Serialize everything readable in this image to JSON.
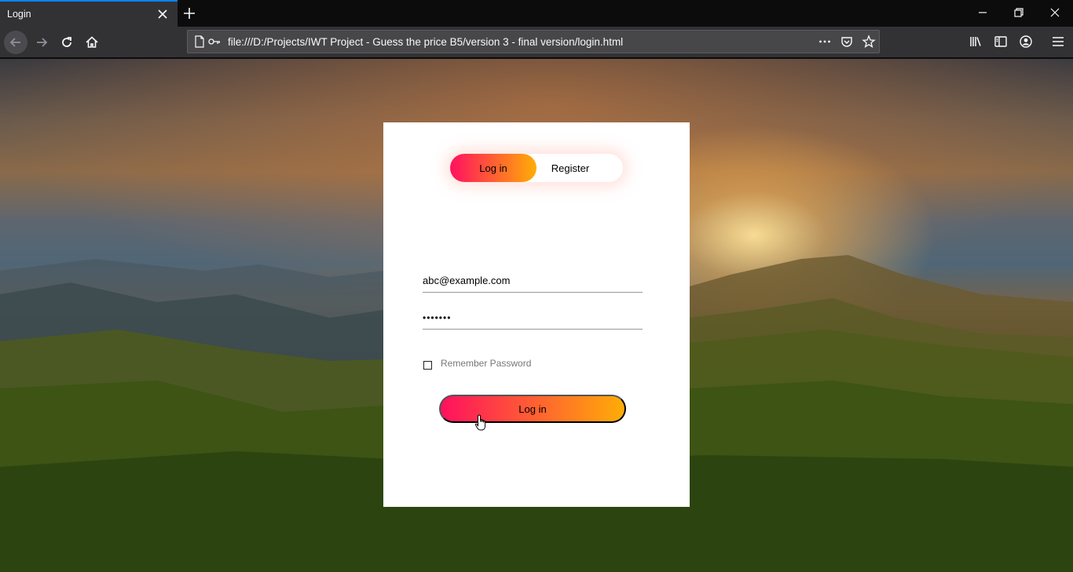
{
  "browser": {
    "tab": {
      "title": "Login"
    },
    "url": "file:///D:/Projects/IWT Project - Guess the price B5/version 3 - final version/login.html",
    "icons": {
      "tab_close": "close-icon",
      "new_tab": "plus-icon",
      "minimize": "minimize-icon",
      "restore": "restore-icon",
      "close_window": "close-icon",
      "back": "back-arrow-icon",
      "forward": "forward-arrow-icon",
      "reload": "reload-icon",
      "home": "home-icon",
      "page": "page-icon",
      "key": "key-icon",
      "more": "more-dots-icon",
      "pocket": "pocket-icon",
      "bookmark": "star-icon",
      "library": "library-icon",
      "sidebar": "sidebar-icon",
      "account": "account-icon",
      "menu": "hamburger-menu-icon"
    }
  },
  "login_card": {
    "toggle": {
      "login_label": "Log in",
      "register_label": "Register",
      "active": "login"
    },
    "email_value": "abc@example.com",
    "password_dots": "•••••••",
    "remember_label": "Remember Password",
    "remember_checked": false,
    "submit_label": "Log in"
  },
  "colors": {
    "gradient_start": "#ff105f",
    "gradient_end": "#ffad06",
    "chrome_dark": "#0c0c0d",
    "chrome_toolbar": "#323234",
    "accent": "#0a84ff"
  }
}
